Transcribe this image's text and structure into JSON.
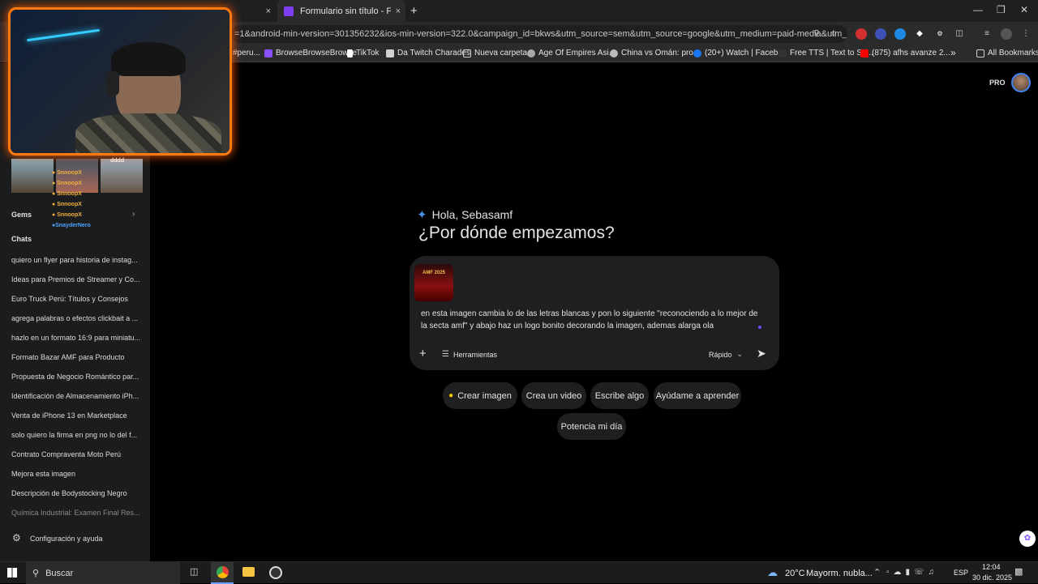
{
  "browser": {
    "tabs": [
      {
        "label": "Formulario sin título - Formula",
        "active": true
      }
    ],
    "close_glyph": "×",
    "new_tab_glyph": "+",
    "url": "=1&android-min-version=301356232&ios-min-version=322.0&campaign_id=bkws&utm_source=sem&utm_source=google&utm_medium=paid-media&utm_medium=...",
    "bookmarks": [
      {
        "label": "#peru...",
        "color": "#888888"
      },
      {
        "label": "BrowseBrowseBrowse",
        "color": "#8a4fff"
      },
      {
        "label": "TikTok",
        "color": "#ffffff"
      },
      {
        "label": "Da Twitch Charades",
        "color": "#d0d0d0"
      },
      {
        "label": "Nueva carpeta",
        "color": "#d0d0d0"
      },
      {
        "label": "Age Of Empires Asi...",
        "color": "#d0d0d0"
      },
      {
        "label": "China vs Omán: pro...",
        "color": "#d0d0d0"
      },
      {
        "label": "(20+) Watch | Faceb...",
        "color": "#1877f2"
      },
      {
        "label": "Free TTS | Text to Sp...",
        "color": "#d0d0d0"
      },
      {
        "label": "(875) afhs avanze 2...",
        "color": "#ff0000"
      }
    ],
    "more_glyph": "»",
    "all_bookmarks": "All Bookmarks"
  },
  "header": {
    "pro_badge": "PRO"
  },
  "sidebar": {
    "stream_chat": [
      "SnnoopX",
      "SnnoopX",
      "SnnoopX",
      "SnnoopX",
      "SnnoopX",
      "SnayderNero"
    ],
    "overlay_caption": "dddd",
    "gems_label": "Gems",
    "chats_label": "Chats",
    "chats": [
      "quiero un flyer para historia de instag...",
      "Ideas para Premios de Streamer y Co...",
      "Euro Truck Perú: Títulos y Consejos",
      "agrega palabras o efectos clickbait a ...",
      "hazlo en un formato 16:9 para miniatu...",
      "Formato Bazar AMF para Producto",
      "Propuesta de Negocio Romántico par...",
      "Identificación de Almacenamiento iPh...",
      "Venta de iPhone 13 en Marketplace",
      "solo quiero la firma en png no lo del f...",
      "Contrato Compraventa Moto Perú",
      "Mejora esta imagen",
      "Descripción de Bodystocking Negro",
      "Química Industrial: Examen Final Res..."
    ],
    "settings_label": "Configuración y ayuda"
  },
  "main": {
    "greeting": "Hola, Sebasamf",
    "headline": "¿Por dónde empezamos?",
    "attachment_caption": "AMF 2025",
    "prompt_text": "en esta imagen cambia lo de las letras blancas y pon lo siguiente \"reconociendo a lo mejor de la secta amf\" y abajo haz un logo bonito decorando la imagen, ademas alarga ola",
    "tools_label": "Herramientas",
    "mode_label": "Rápido",
    "chips": [
      "Crear imagen",
      "Crea un video",
      "Escribe algo",
      "Ayúdame a aprender",
      "Potencia mi día"
    ]
  },
  "taskbar": {
    "search_placeholder": "Buscar",
    "weather_temp": "20°C",
    "weather_desc": "Mayorm. nubla...",
    "language": "ESP",
    "time": "12:04",
    "date": "30 dic. 2025"
  },
  "colors": {
    "accent_blue": "#4285f4",
    "webcam_border": "#ff7a10",
    "send": "#e3e3e3"
  }
}
